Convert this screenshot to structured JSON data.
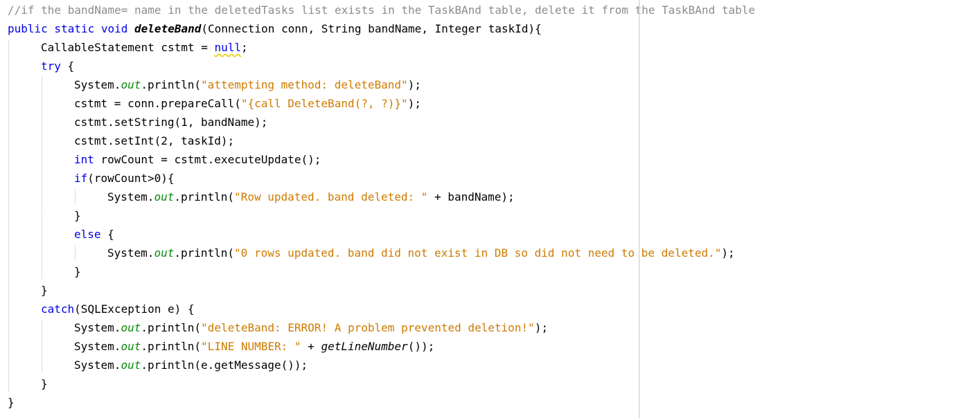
{
  "lines": [
    {
      "indent": 0,
      "tokens": [
        {
          "t": "//if the bandName= name in the deletedTasks list exists in the TaskBAnd table, delete it from the TaskBAnd table",
          "c": "comment"
        }
      ]
    },
    {
      "indent": 0,
      "tokens": [
        {
          "t": "public static void ",
          "c": "kw"
        },
        {
          "t": "deleteBand",
          "c": "fn"
        },
        {
          "t": "(Connection conn, String bandName, Integer taskId){",
          "c": ""
        }
      ]
    },
    {
      "indent": 1,
      "tokens": [
        {
          "t": "CallableStatement cstmt = ",
          "c": ""
        },
        {
          "t": "null",
          "c": "kw warn"
        },
        {
          "t": ";",
          "c": ""
        }
      ]
    },
    {
      "indent": 1,
      "tokens": [
        {
          "t": "try",
          "c": "kw"
        },
        {
          "t": " {",
          "c": ""
        }
      ]
    },
    {
      "indent": 2,
      "tokens": [
        {
          "t": "System.",
          "c": ""
        },
        {
          "t": "out",
          "c": "field"
        },
        {
          "t": ".println(",
          "c": ""
        },
        {
          "t": "\"attempting method: deleteBand\"",
          "c": "str"
        },
        {
          "t": ");",
          "c": ""
        }
      ]
    },
    {
      "indent": 2,
      "tokens": [
        {
          "t": "cstmt = conn.prepareCall(",
          "c": ""
        },
        {
          "t": "\"{call DeleteBand(?, ?)}\"",
          "c": "str"
        },
        {
          "t": ");",
          "c": ""
        }
      ]
    },
    {
      "indent": 2,
      "tokens": [
        {
          "t": "cstmt.setString(1, bandName);",
          "c": ""
        }
      ]
    },
    {
      "indent": 2,
      "tokens": [
        {
          "t": "cstmt.setInt(2, taskId);",
          "c": ""
        }
      ]
    },
    {
      "indent": 2,
      "tokens": [
        {
          "t": "int",
          "c": "kw"
        },
        {
          "t": " rowCount = cstmt.executeUpdate();",
          "c": ""
        }
      ]
    },
    {
      "indent": 2,
      "tokens": [
        {
          "t": "if",
          "c": "kw"
        },
        {
          "t": "(rowCount>0){",
          "c": ""
        }
      ]
    },
    {
      "indent": 3,
      "tokens": [
        {
          "t": "System.",
          "c": ""
        },
        {
          "t": "out",
          "c": "field"
        },
        {
          "t": ".println(",
          "c": ""
        },
        {
          "t": "\"Row updated. band deleted: \"",
          "c": "str"
        },
        {
          "t": " + bandName);",
          "c": ""
        }
      ]
    },
    {
      "indent": 2,
      "tokens": [
        {
          "t": "}",
          "c": ""
        }
      ]
    },
    {
      "indent": 2,
      "tokens": [
        {
          "t": "else",
          "c": "kw"
        },
        {
          "t": " {",
          "c": ""
        }
      ]
    },
    {
      "indent": 3,
      "tokens": [
        {
          "t": "System.",
          "c": ""
        },
        {
          "t": "out",
          "c": "field"
        },
        {
          "t": ".println(",
          "c": ""
        },
        {
          "t": "\"0 rows updated. band did not exist in DB so did not need to be deleted.\"",
          "c": "str"
        },
        {
          "t": ");",
          "c": ""
        }
      ]
    },
    {
      "indent": 2,
      "tokens": [
        {
          "t": "}",
          "c": ""
        }
      ]
    },
    {
      "indent": 1,
      "tokens": [
        {
          "t": "}",
          "c": ""
        }
      ]
    },
    {
      "indent": 1,
      "tokens": [
        {
          "t": "catch",
          "c": "kw"
        },
        {
          "t": "(SQLException e) {",
          "c": ""
        }
      ]
    },
    {
      "indent": 2,
      "tokens": [
        {
          "t": "System.",
          "c": ""
        },
        {
          "t": "out",
          "c": "field"
        },
        {
          "t": ".println(",
          "c": ""
        },
        {
          "t": "\"deleteBand: ERROR! A problem prevented deletion!\"",
          "c": "str"
        },
        {
          "t": ");",
          "c": ""
        }
      ]
    },
    {
      "indent": 2,
      "tokens": [
        {
          "t": "System.",
          "c": ""
        },
        {
          "t": "out",
          "c": "field"
        },
        {
          "t": ".println(",
          "c": ""
        },
        {
          "t": "\"LINE NUMBER: \"",
          "c": "str"
        },
        {
          "t": " + ",
          "c": ""
        },
        {
          "t": "getLineNumber",
          "c": "italic"
        },
        {
          "t": "());",
          "c": ""
        }
      ]
    },
    {
      "indent": 2,
      "tokens": [
        {
          "t": "System.",
          "c": ""
        },
        {
          "t": "out",
          "c": "field"
        },
        {
          "t": ".println(e.getMessage());",
          "c": ""
        }
      ]
    },
    {
      "indent": 1,
      "tokens": [
        {
          "t": "}",
          "c": ""
        }
      ]
    },
    {
      "indent": 0,
      "tokens": [
        {
          "t": "}",
          "c": ""
        }
      ]
    }
  ],
  "colors": {
    "keyword": "#0000e6",
    "string": "#ce7b00",
    "comment": "#8c8c8c",
    "static_field": "#0a8a0a",
    "background": "#ffffff"
  }
}
